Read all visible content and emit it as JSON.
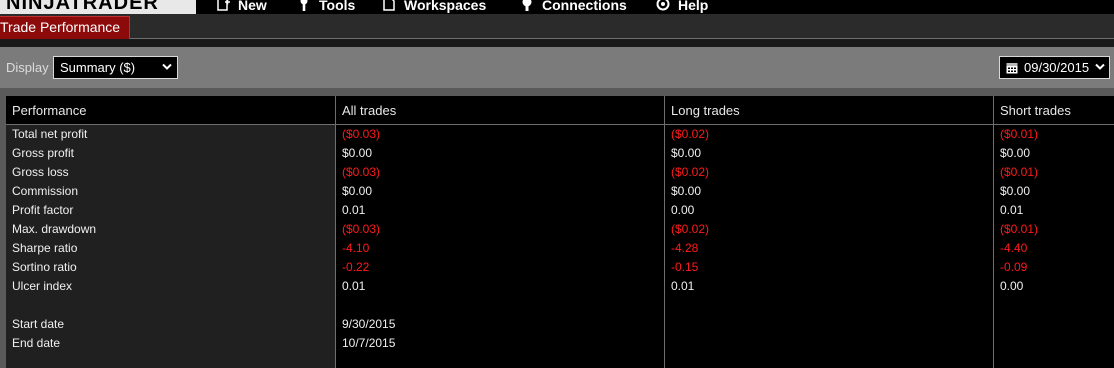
{
  "app": {
    "logo_text": "NINJATRADER"
  },
  "menu": [
    {
      "label": "New",
      "icon": "new-icon"
    },
    {
      "label": "Tools",
      "icon": "tools-icon"
    },
    {
      "label": "Workspaces",
      "icon": "workspaces-icon"
    },
    {
      "label": "Connections",
      "icon": "connections-icon"
    },
    {
      "label": "Help",
      "icon": "help-icon"
    }
  ],
  "tab": {
    "label": "Trade Performance"
  },
  "toolbar": {
    "display_label": "Display",
    "display_value": "Summary ($)",
    "date_value": "09/30/2015"
  },
  "grid": {
    "columns": [
      "Performance",
      "All trades",
      "Long trades",
      "Short trades"
    ],
    "rows": [
      {
        "label": "Total net profit",
        "all": "($0.03)",
        "long": "($0.02)",
        "short": "($0.01)",
        "negative": true
      },
      {
        "label": "Gross profit",
        "all": "$0.00",
        "long": "$0.00",
        "short": "$0.00",
        "negative": false
      },
      {
        "label": "Gross loss",
        "all": "($0.03)",
        "long": "($0.02)",
        "short": "($0.01)",
        "negative": true
      },
      {
        "label": "Commission",
        "all": "$0.00",
        "long": "$0.00",
        "short": "$0.00",
        "negative": false
      },
      {
        "label": "Profit factor",
        "all": "0.01",
        "long": "0.00",
        "short": "0.01",
        "negative": false
      },
      {
        "label": "Max. drawdown",
        "all": "($0.03)",
        "long": "($0.02)",
        "short": "($0.01)",
        "negative": true
      },
      {
        "label": "Sharpe ratio",
        "all": "-4.10",
        "long": "-4.28",
        "short": "-4.40",
        "negative": true
      },
      {
        "label": "Sortino ratio",
        "all": "-0.22",
        "long": "-0.15",
        "short": "-0.09",
        "negative": true
      },
      {
        "label": "Ulcer index",
        "all": "0.01",
        "long": "0.01",
        "short": "0.00",
        "negative": false
      },
      {
        "label": "",
        "all": "",
        "long": "",
        "short": "",
        "negative": false
      },
      {
        "label": "Start date",
        "all": "9/30/2015",
        "long": "",
        "short": "",
        "negative": false
      },
      {
        "label": "End date",
        "all": "10/7/2015",
        "long": "",
        "short": "",
        "negative": false
      }
    ]
  },
  "colors": {
    "accent": "#8c0a0a",
    "negative": "#ff1a1a",
    "toolbar": "#7b7b7b"
  }
}
